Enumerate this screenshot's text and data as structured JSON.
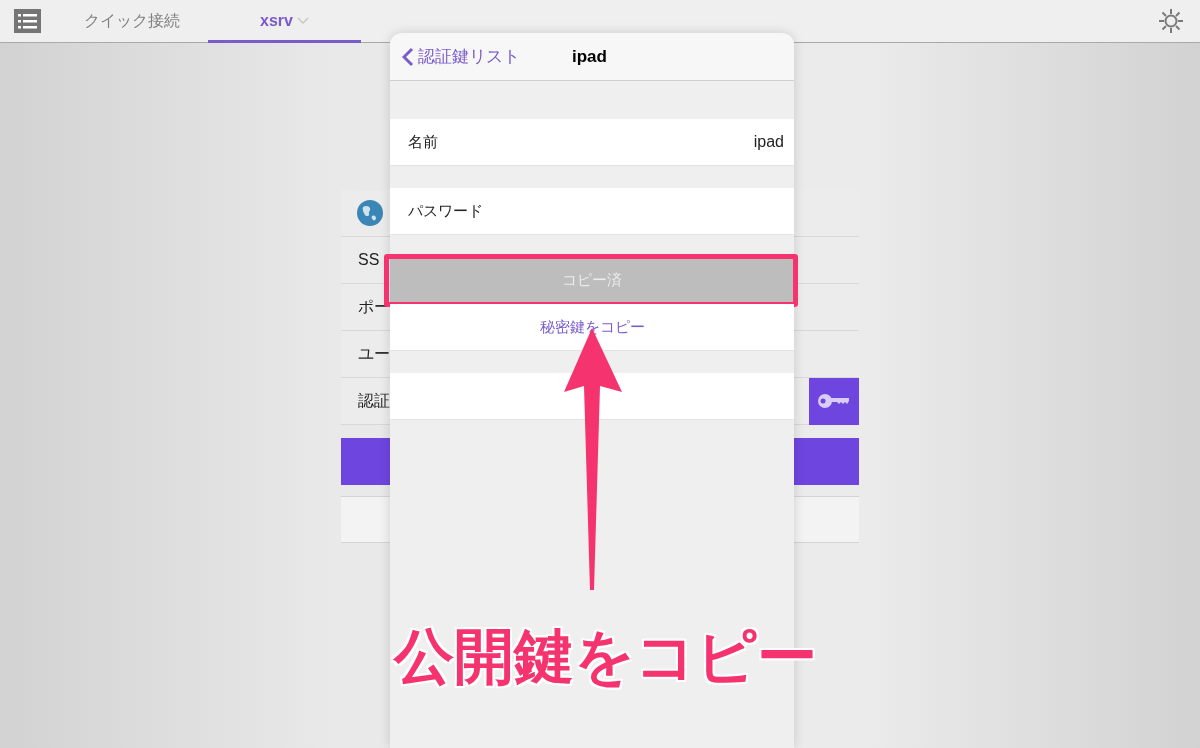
{
  "top_bar": {
    "tabs": [
      {
        "label": "クイック接続",
        "selected": false,
        "dropdown": false
      },
      {
        "label": "xsrv",
        "selected": true,
        "dropdown": true
      }
    ]
  },
  "background_form": {
    "rows": [
      {
        "kind": "globe"
      },
      {
        "kind": "text",
        "label": "SS"
      },
      {
        "kind": "text",
        "label": "ポー"
      },
      {
        "kind": "text",
        "label": "ユー"
      },
      {
        "kind": "key",
        "label": "認証"
      },
      {
        "kind": "button"
      },
      {
        "kind": "blank"
      }
    ]
  },
  "popover": {
    "back_label": "認証鍵リスト",
    "title": "ipad",
    "sections": [
      {
        "rows": [
          {
            "kind": "field",
            "label": "名前",
            "value": "ipad"
          }
        ]
      },
      {
        "rows": [
          {
            "kind": "field",
            "label": "パスワード"
          }
        ]
      },
      {
        "rows": [
          {
            "kind": "button",
            "label": "コピー済",
            "disabled": true,
            "highlighted": true
          },
          {
            "kind": "button",
            "label": "秘密鍵をコピー",
            "disabled": false,
            "highlighted": false
          }
        ]
      },
      {
        "rows": [
          {
            "kind": "button",
            "disabled": false,
            "highlighted": false
          }
        ]
      }
    ]
  },
  "annotation": {
    "label": "公開鍵をコピー"
  }
}
